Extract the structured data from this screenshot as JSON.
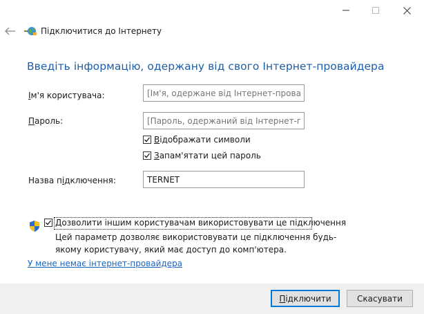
{
  "window": {
    "title": "Підключитися до Інтернету"
  },
  "heading": "Введіть інформацію, одержану від свого Інтернет-провайдера",
  "form": {
    "username": {
      "label_prefix": "І",
      "label_rest": "м'я користувача:",
      "placeholder": "[Ім'я, одержане від Інтернет-провайдера]"
    },
    "password": {
      "label_prefix": "П",
      "label_rest": "ароль:",
      "placeholder": "[Пароль, одержаний від Інтернет-провайдера]"
    },
    "show_chars": {
      "label_prefix": "В",
      "label_rest": "ідображати символи",
      "checked": true
    },
    "remember": {
      "label_prefix": "З",
      "label_rest": "апам'ятати цей пароль",
      "checked": true
    },
    "connection_name": {
      "label_part1": "Назва п",
      "label_underlined": "і",
      "label_part2": "дключення:",
      "value": "TERNET"
    },
    "allow_others": {
      "label_prefix": "Д",
      "label_rest": "озволити іншим користувачам використовувати це підключення",
      "checked": true,
      "description": "Цей параметр дозволяє використовувати це підключення будь-якому користувачу, який має доступ до комп'ютера."
    }
  },
  "link": "У мене немає інтернет-провайдера",
  "buttons": {
    "connect_prefix": "П",
    "connect_rest": "ідключити",
    "cancel": "Скасувати"
  },
  "icons": {
    "app": "network-globe-icon",
    "shield": "uac-shield-icon"
  }
}
